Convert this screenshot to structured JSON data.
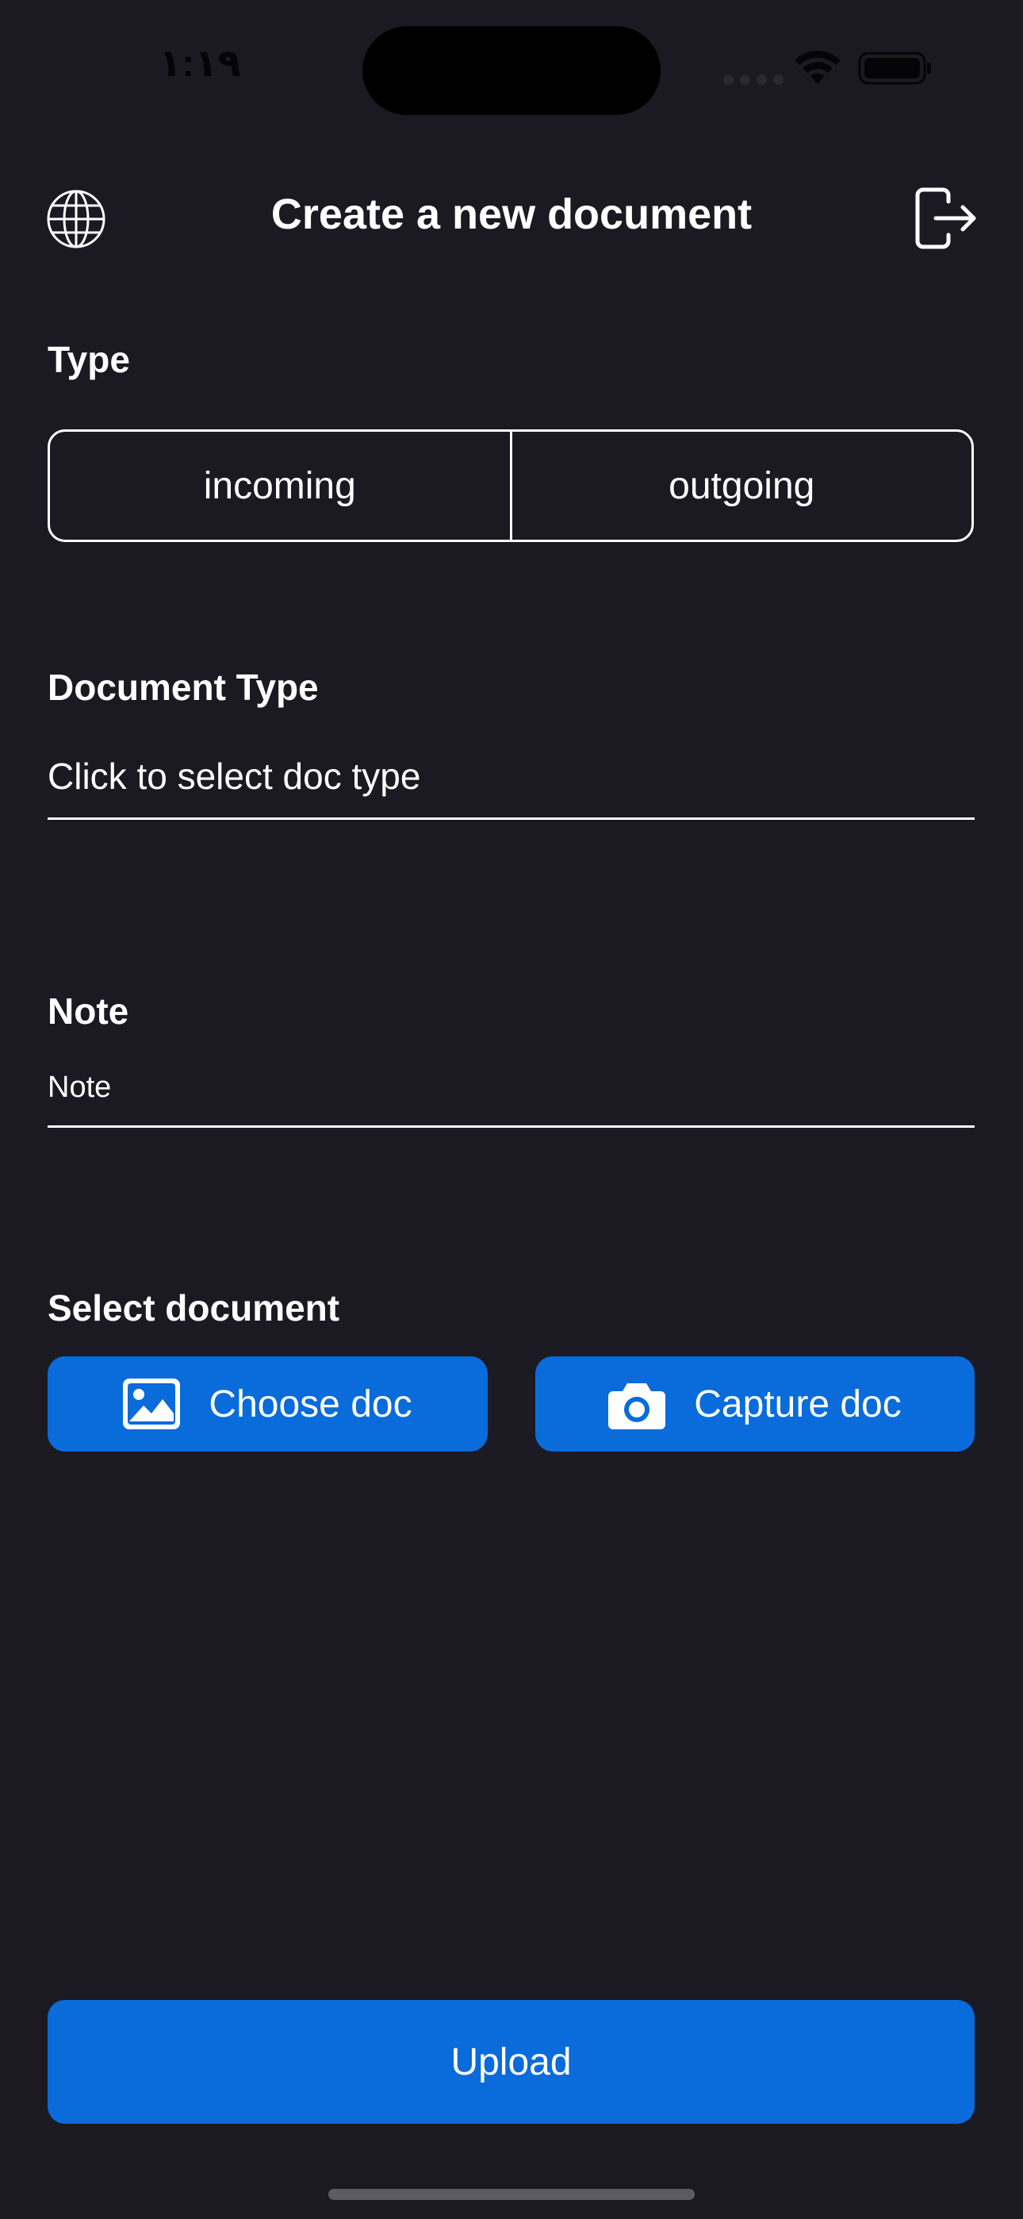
{
  "status_bar": {
    "time": "١:١٩"
  },
  "header": {
    "title": "Create a new document"
  },
  "type_section": {
    "label": "Type",
    "options": [
      "incoming",
      "outgoing"
    ]
  },
  "document_type": {
    "label": "Document Type",
    "value": "Click to select doc type"
  },
  "note": {
    "label": "Note",
    "placeholder": "Note"
  },
  "select_document": {
    "label": "Select document",
    "choose_label": "Choose doc",
    "capture_label": "Capture doc"
  },
  "upload": {
    "label": "Upload"
  },
  "icons": {
    "globe": "globe-icon",
    "logout": "logout-icon",
    "image": "image-icon",
    "camera": "camera-icon",
    "wifi": "wifi-icon",
    "battery": "battery-icon"
  },
  "colors": {
    "background": "#1b1a23",
    "accent": "#0a6bdb",
    "text": "#ffffff"
  }
}
